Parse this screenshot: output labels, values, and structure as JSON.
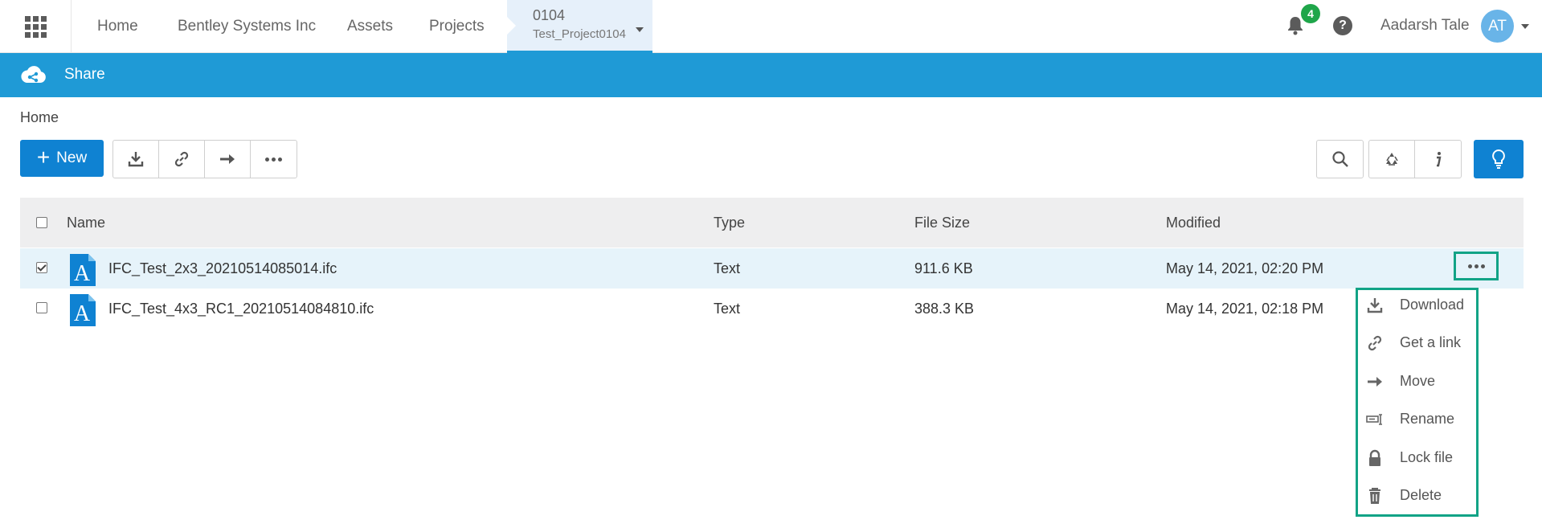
{
  "topbar": {
    "nav": [
      "Home",
      "Bentley Systems Inc",
      "Assets",
      "Projects"
    ],
    "project": {
      "number": "0104",
      "name": "Test_Project0104"
    },
    "notifications_count": "4",
    "help_label": "?",
    "user_name": "Aadarsh Tale",
    "user_initials": "AT"
  },
  "app": {
    "title": "Share"
  },
  "breadcrumb": "Home",
  "toolbar": {
    "new_label": "New"
  },
  "table": {
    "columns": [
      "Name",
      "Type",
      "File Size",
      "Modified"
    ],
    "rows": [
      {
        "name": "IFC_Test_2x3_20210514085014.ifc",
        "type": "Text",
        "size": "911.6 KB",
        "modified": "May 14, 2021, 02:20 PM",
        "selected": true
      },
      {
        "name": "IFC_Test_4x3_RC1_20210514084810.ifc",
        "type": "Text",
        "size": "388.3 KB",
        "modified": "May 14, 2021, 02:18 PM",
        "selected": false
      }
    ]
  },
  "context_menu": {
    "items": [
      {
        "label": "Download",
        "icon": "download-icon"
      },
      {
        "label": "Get a link",
        "icon": "link-icon"
      },
      {
        "label": "Move",
        "icon": "arrow-right-icon"
      },
      {
        "label": "Rename",
        "icon": "rename-icon"
      },
      {
        "label": "Lock file",
        "icon": "lock-icon"
      },
      {
        "label": "Delete",
        "icon": "trash-icon"
      }
    ]
  },
  "colors": {
    "primary": "#0f82d2",
    "brand_bar": "#1f9ad6",
    "highlight": "#12a386",
    "badge": "#1fa64a"
  }
}
